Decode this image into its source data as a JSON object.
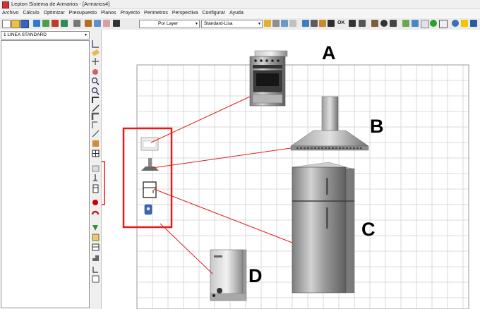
{
  "window": {
    "title": "Lepton Sistema de Armarios - [Armarios4]"
  },
  "menu": [
    "Archivo",
    "Cálculo",
    "Optimizar",
    "Presupuesto",
    "Planos",
    "Proyecto",
    "Perimetros",
    "Perspectiva",
    "Configurar",
    "Ayuda"
  ],
  "toolbar": {
    "layer_combo": "Por Layer",
    "style_combo": "Standard-Lisa",
    "ok_label": "OK"
  },
  "left_panel": {
    "series_combo": "1 LINEA STANDARD"
  },
  "callouts": [
    "A",
    "B",
    "C",
    "D"
  ],
  "appliances": {
    "A": "stove-oven",
    "B": "range-hood",
    "C": "refrigerator",
    "D": "water-heater"
  },
  "colors": {
    "highlight": "#e31b1b",
    "grid": "#cfcfcf",
    "toolbar_bg": "#ebebeb"
  }
}
